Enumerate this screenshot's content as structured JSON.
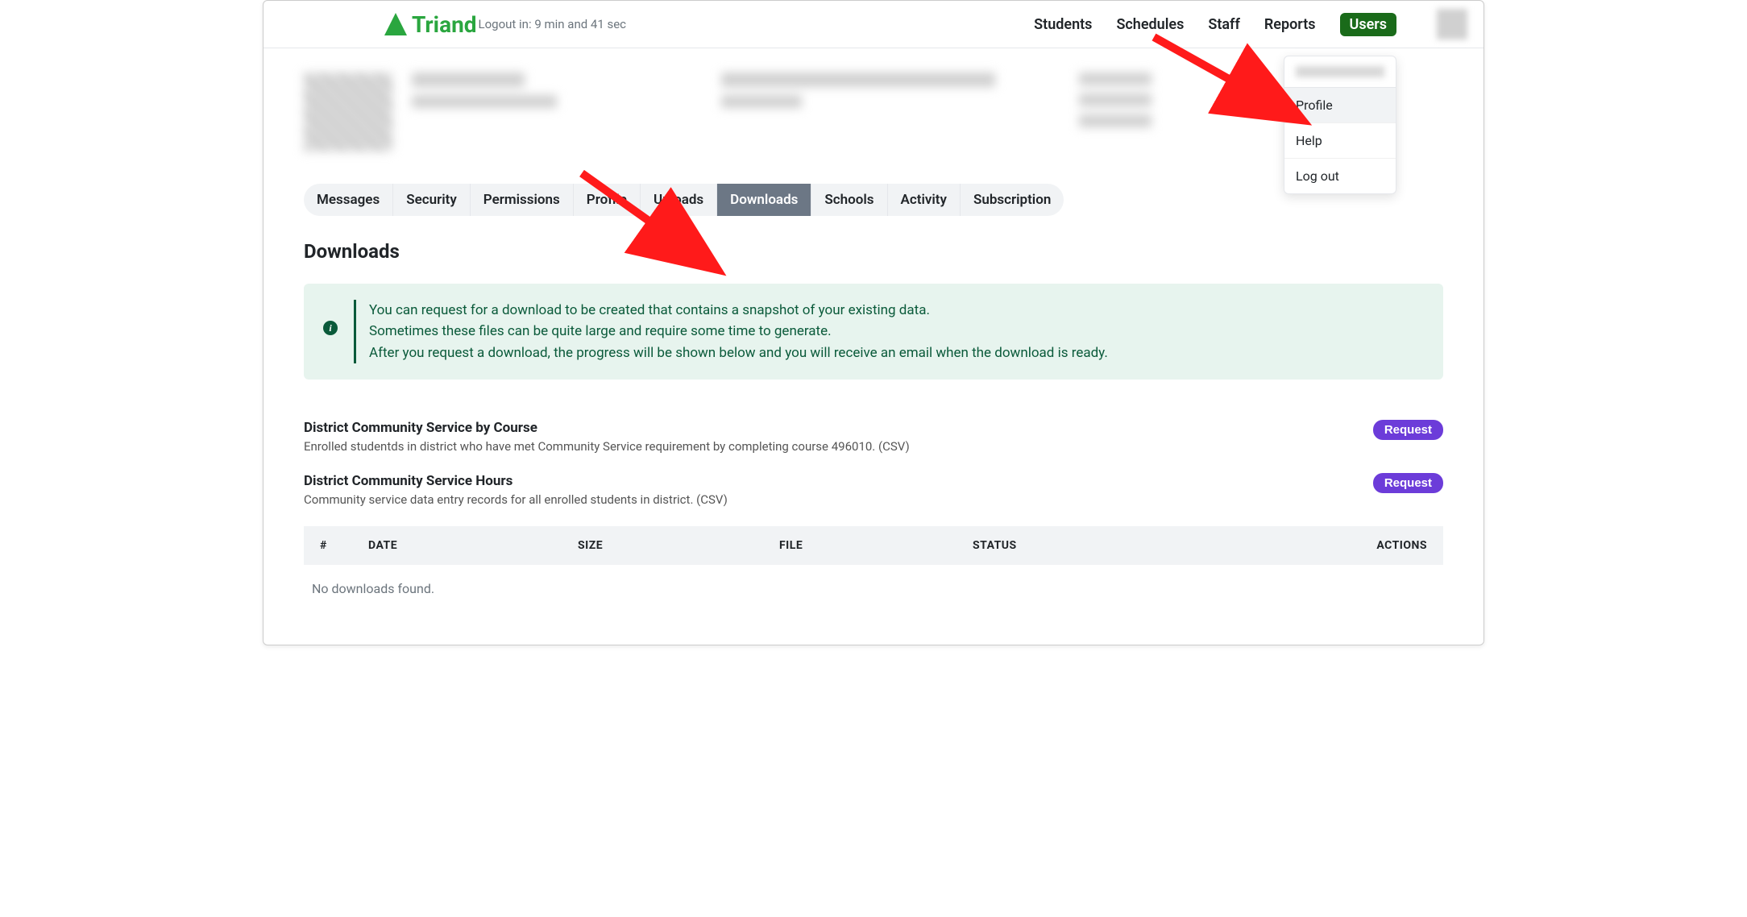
{
  "header": {
    "brand": "Triand",
    "logout_timer": "Logout in: 9 min and 41 sec",
    "nav": [
      "Students",
      "Schedules",
      "Staff",
      "Reports",
      "Users"
    ],
    "nav_active_index": 4
  },
  "dropdown": {
    "items": [
      "Profile",
      "Help",
      "Log out"
    ],
    "hover_index": 0
  },
  "tabs": {
    "items": [
      "Messages",
      "Security",
      "Permissions",
      "Profile",
      "Uploads",
      "Downloads",
      "Schools",
      "Activity",
      "Subscription"
    ],
    "active_index": 5
  },
  "page": {
    "title": "Downloads"
  },
  "notice": {
    "line1": "You can request for a download to be created that contains a snapshot of your existing data.",
    "line2": "Sometimes these files can be quite large and require some time to generate.",
    "line3": "After you request a download, the progress will be shown below and you will receive an email when the download is ready."
  },
  "downloads": [
    {
      "title": "District Community Service by Course",
      "desc": "Enrolled studentds in district who have met Community Service requirement by completing course 496010. (CSV)",
      "button": "Request"
    },
    {
      "title": "District Community Service Hours",
      "desc": "Community service data entry records for all enrolled students in district. (CSV)",
      "button": "Request"
    }
  ],
  "table": {
    "headers": [
      "#",
      "DATE",
      "SIZE",
      "FILE",
      "STATUS",
      "ACTIONS"
    ],
    "empty_message": "No downloads found."
  }
}
